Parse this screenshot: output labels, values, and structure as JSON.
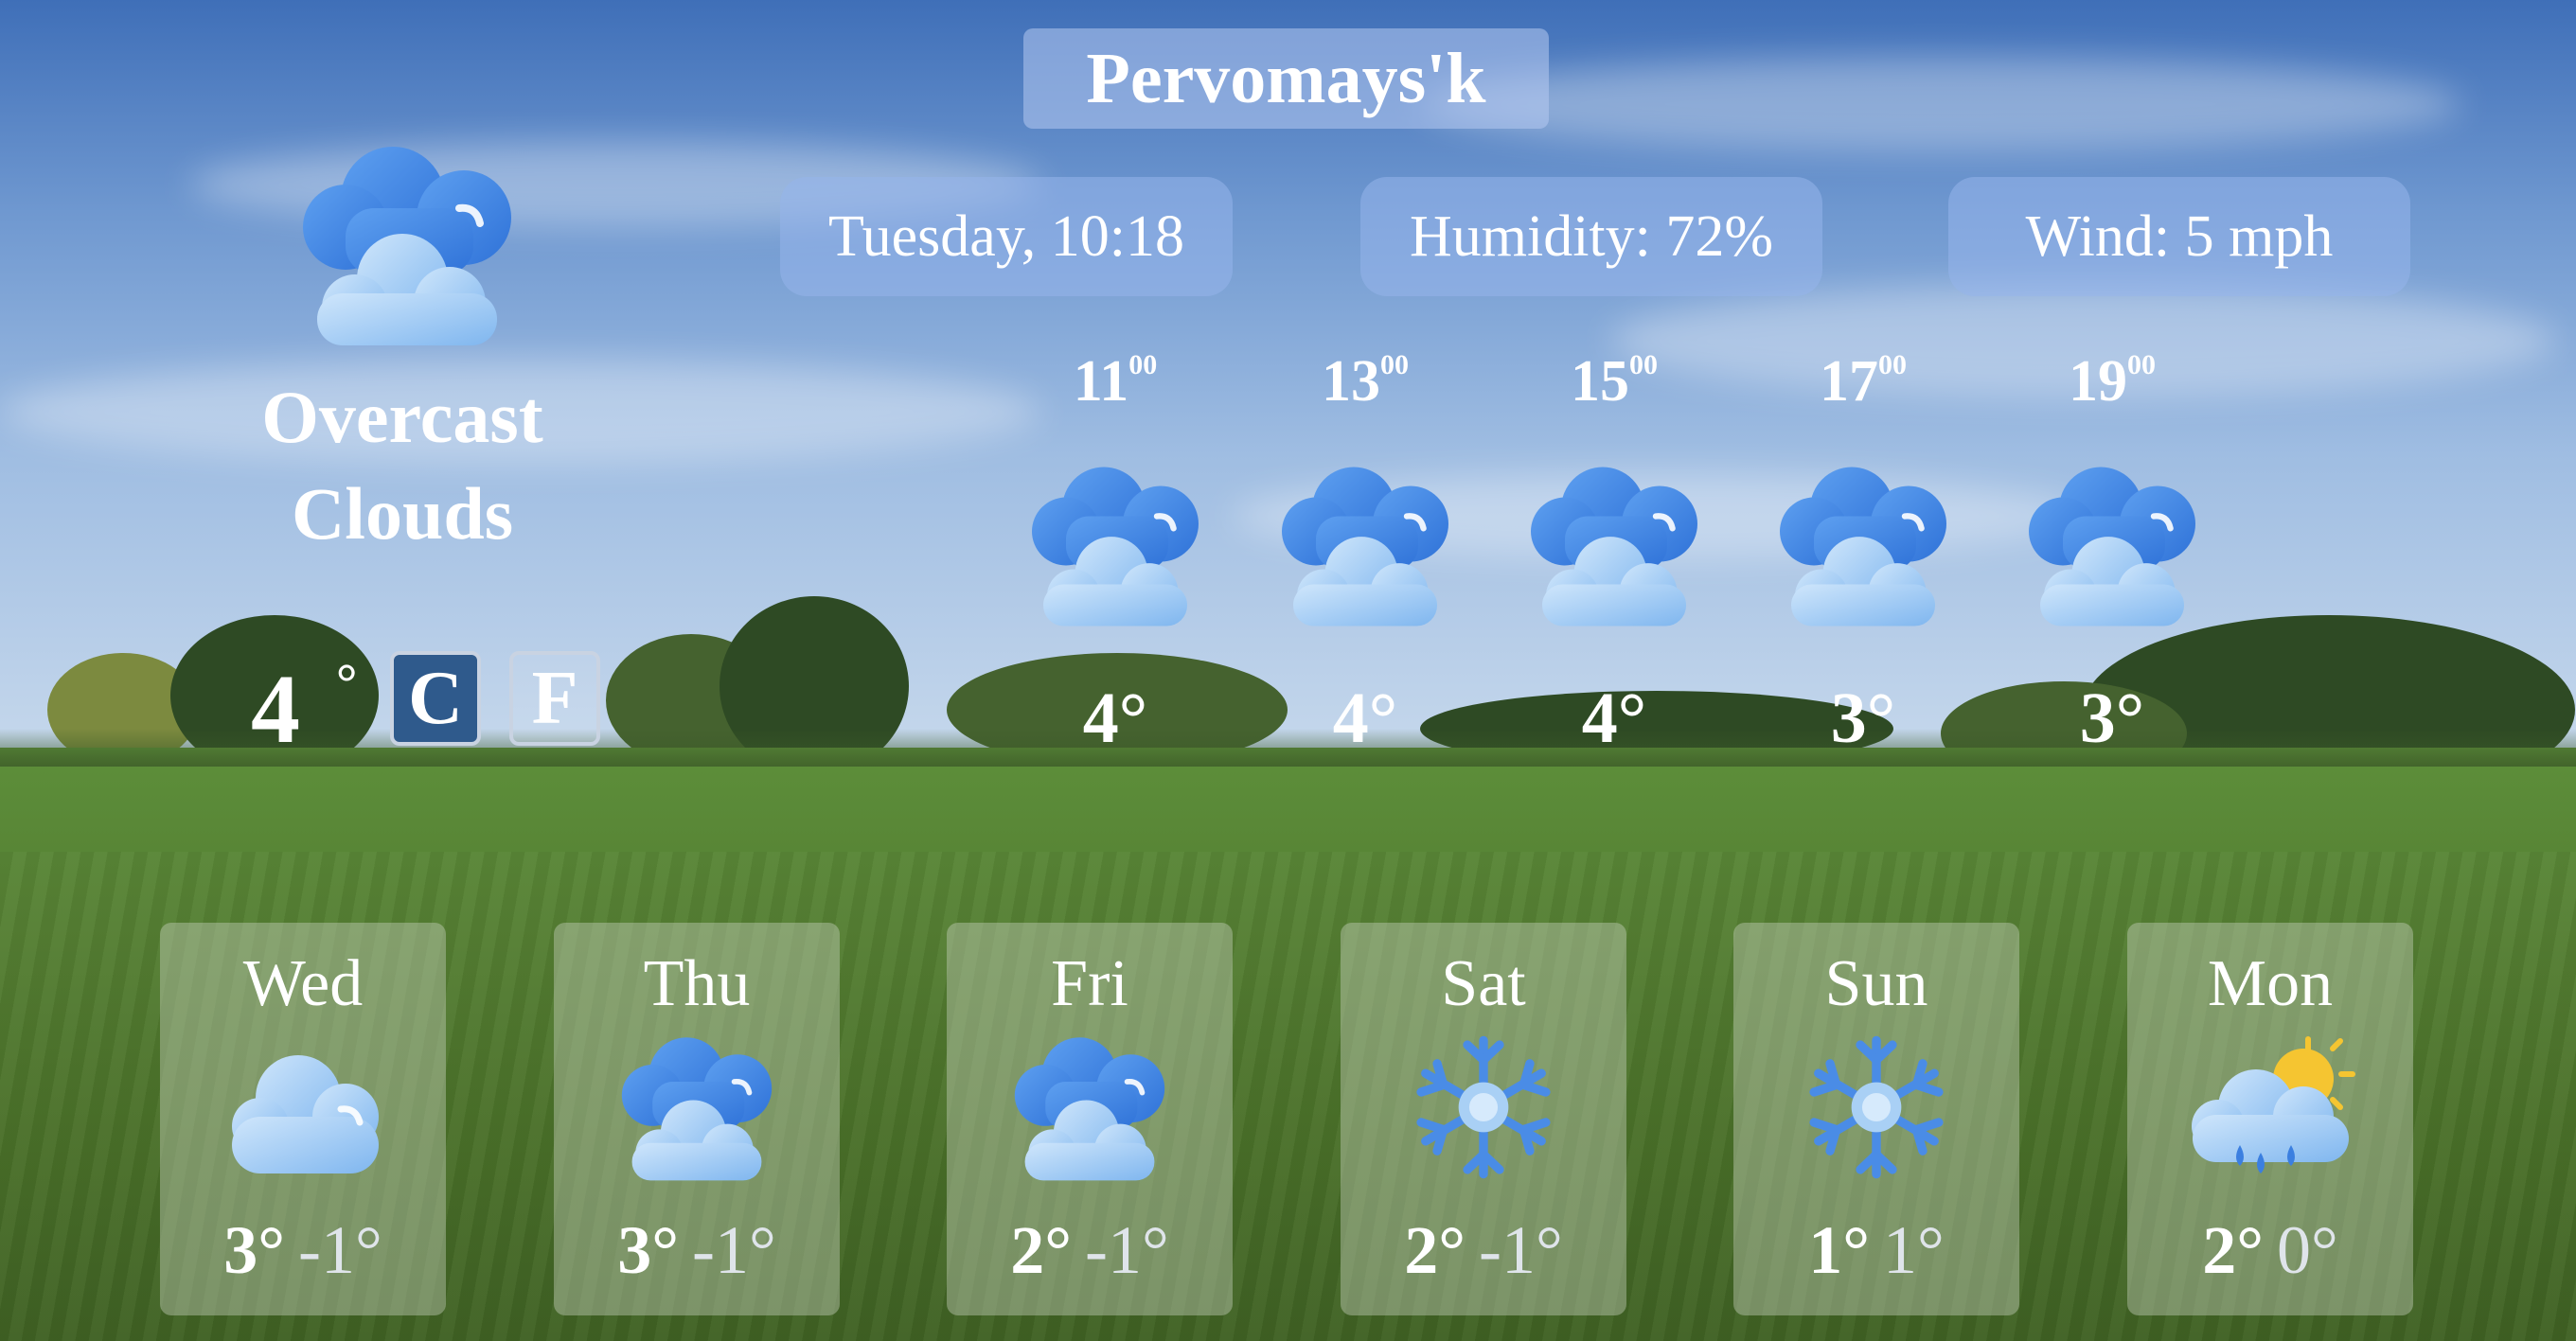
{
  "city": "Pervomays'k",
  "current": {
    "day_time": "Tuesday, 10:18",
    "humidity": "Humidity: 72%",
    "wind": "Wind: 5 mph",
    "condition_line1": "Overcast",
    "condition_line2": "Clouds",
    "temperature": "4",
    "degree_symbol": "°",
    "icon": "overcast-clouds-icon"
  },
  "units": {
    "celsius": "C",
    "fahrenheit": "F",
    "selected": "C"
  },
  "hourly": [
    {
      "hour": "11",
      "minutes": "00",
      "temp": "4°",
      "icon": "overcast-clouds-icon"
    },
    {
      "hour": "13",
      "minutes": "00",
      "temp": "4°",
      "icon": "overcast-clouds-icon"
    },
    {
      "hour": "15",
      "minutes": "00",
      "temp": "4°",
      "icon": "overcast-clouds-icon"
    },
    {
      "hour": "17",
      "minutes": "00",
      "temp": "3°",
      "icon": "overcast-clouds-icon"
    },
    {
      "hour": "19",
      "minutes": "00",
      "temp": "3°",
      "icon": "overcast-clouds-icon"
    }
  ],
  "daily": [
    {
      "day": "Wed",
      "high": "3°",
      "low": "-1°",
      "icon": "cloud-icon"
    },
    {
      "day": "Thu",
      "high": "3°",
      "low": "-1°",
      "icon": "overcast-clouds-icon"
    },
    {
      "day": "Fri",
      "high": "2°",
      "low": "-1°",
      "icon": "overcast-clouds-icon"
    },
    {
      "day": "Sat",
      "high": "2°",
      "low": "-1°",
      "icon": "snowflake-icon"
    },
    {
      "day": "Sun",
      "high": "1°",
      "low": "1°",
      "icon": "snowflake-icon"
    },
    {
      "day": "Mon",
      "high": "2°",
      "low": "0°",
      "icon": "sun-rain-cloud-icon"
    }
  ],
  "colors": {
    "icon_blue_dark": "#3b7fe0",
    "icon_blue_light": "#a9d0f5",
    "sun": "#f5c531",
    "unit_selected": "#2f5a8c"
  }
}
